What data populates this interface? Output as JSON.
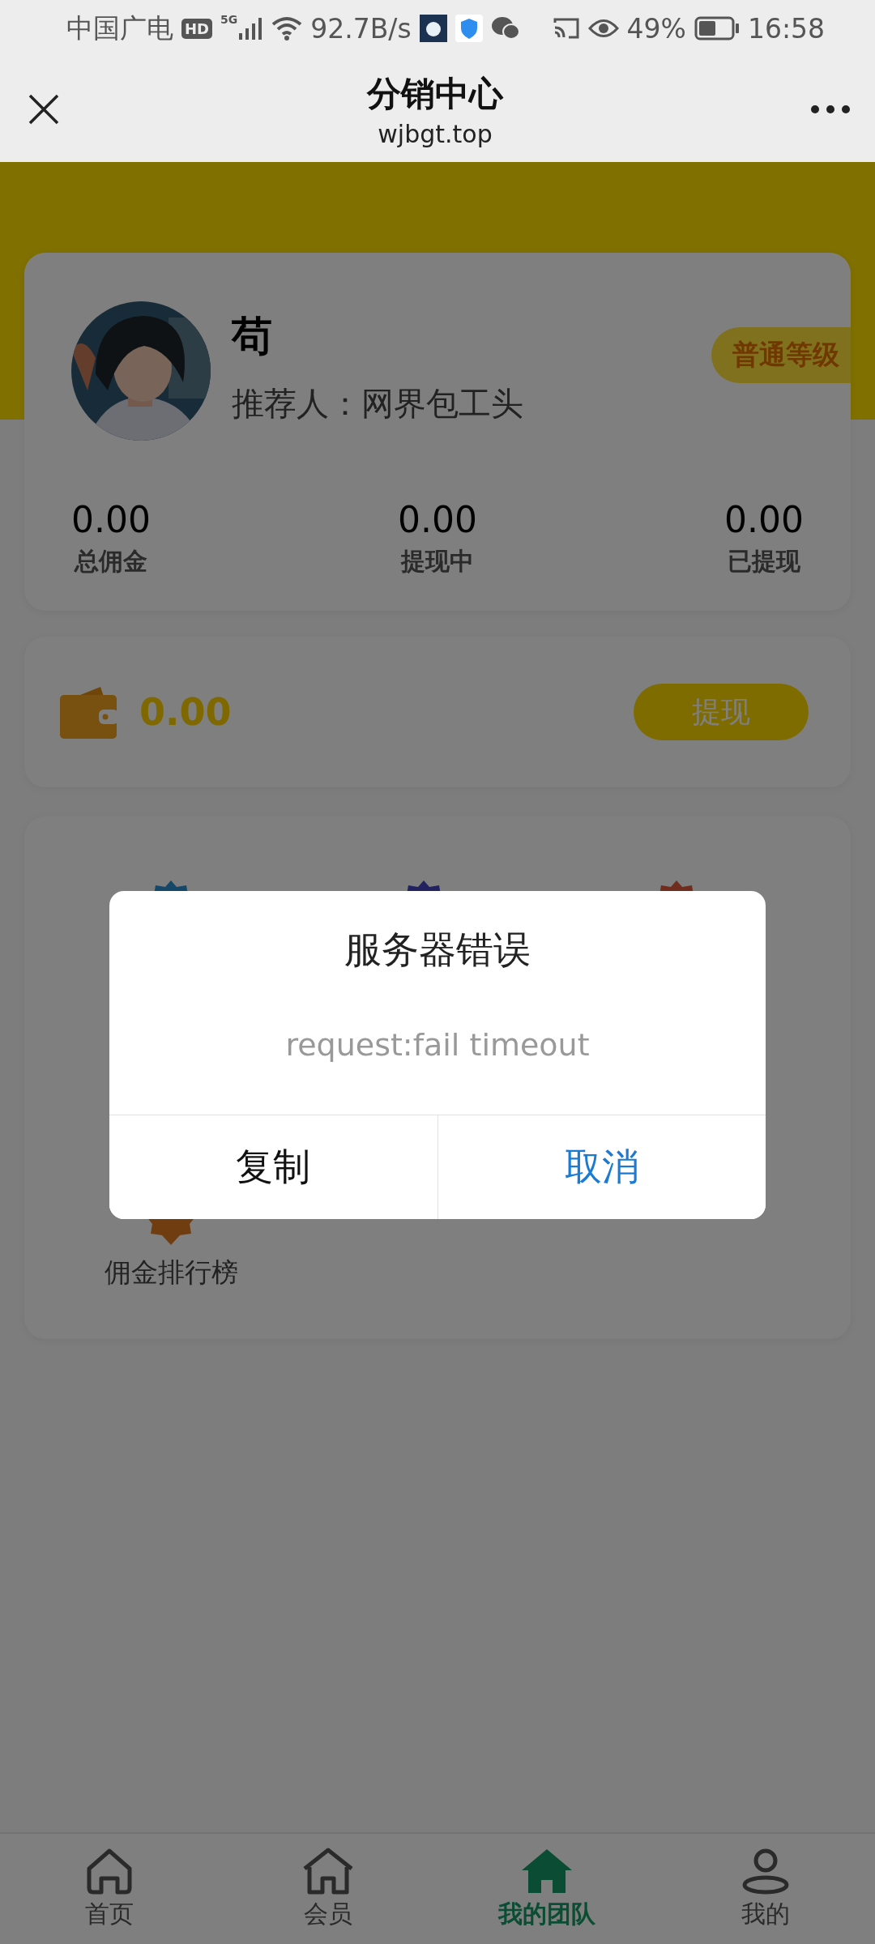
{
  "status_bar": {
    "carrier": "中国广电",
    "hd_badge": "HD",
    "network": "5G",
    "speed": "92.7B/s",
    "battery": "49%",
    "time": "16:58"
  },
  "header": {
    "title": "分销中心",
    "subtitle": "wjbgt.top"
  },
  "profile": {
    "name": "苟",
    "referrer": "推荐人：网界包工头",
    "level_badge": "普通等级"
  },
  "stats": [
    {
      "value": "0.00",
      "label": "总佣金"
    },
    {
      "value": "0.00",
      "label": "提现中"
    },
    {
      "value": "0.00",
      "label": "已提现"
    }
  ],
  "wallet": {
    "amount": "0.00",
    "button": "提现"
  },
  "menu_items": [
    {
      "color": "#154868"
    },
    {
      "color": "#222260"
    },
    {
      "color": "#702d1d"
    },
    {
      "color": "#703d10",
      "label": "佣金排行榜"
    }
  ],
  "dialog": {
    "title": "服务器错误",
    "message": "request:fail timeout",
    "buttons": [
      {
        "label": "复制",
        "kind": "default"
      },
      {
        "label": "取消",
        "kind": "primary"
      }
    ]
  },
  "tabs": [
    {
      "label": "首页",
      "kind": "home",
      "selected": false
    },
    {
      "label": "会员",
      "kind": "member",
      "selected": false
    },
    {
      "label": "我的团队",
      "kind": "team",
      "selected": true
    },
    {
      "label": "我的",
      "kind": "user",
      "selected": false
    }
  ]
}
